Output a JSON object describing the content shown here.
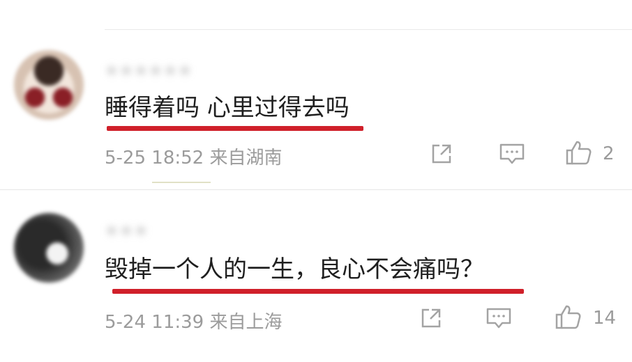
{
  "comments": [
    {
      "username": "＊＊＊＊＊＊",
      "text": "睡得着吗 心里过得去吗",
      "meta": "5-25 18:52 来自湖南",
      "like_count": "2"
    },
    {
      "username": "＊＊＊",
      "text": "毁掉一个人的一生，良心不会痛吗？",
      "meta": "5-24 11:39 来自上海",
      "like_count": "14"
    }
  ],
  "icons": {
    "share": "share-icon",
    "comment": "comment-icon",
    "like": "thumbs-up-icon"
  },
  "colors": {
    "highlight_underline": "#d0202a",
    "meta_gray": "#9b9b9b",
    "text_dark": "#1f1f1f"
  }
}
